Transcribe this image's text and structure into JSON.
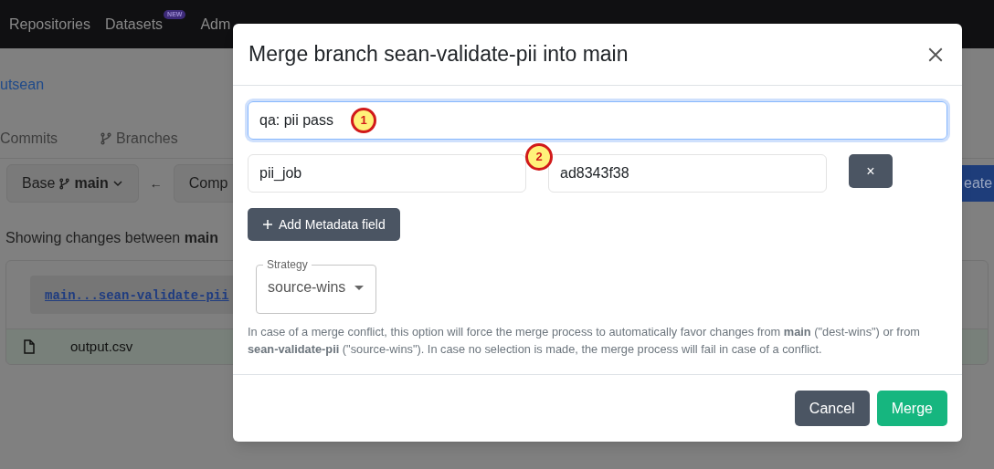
{
  "nav": {
    "items": [
      {
        "label": "Repositories"
      },
      {
        "label": "Datasets",
        "badge": "NEW"
      },
      {
        "label": "Adm"
      }
    ]
  },
  "breadcrumb": "utsean",
  "tabs": [
    {
      "label": "Commits",
      "kind": "plain"
    },
    {
      "label": "Branches",
      "kind": "branch"
    }
  ],
  "compare": {
    "base_label": "Base",
    "base_branch": "main",
    "arrow": "←",
    "compare_label": "Comp",
    "create_button": "eate"
  },
  "summary": {
    "text": "Showing changes between **main**"
  },
  "diff": {
    "range_link": "main...sean-validate-pii",
    "files": [
      {
        "name": "output.csv"
      }
    ]
  },
  "dialog": {
    "title": "Merge branch sean-validate-pii into main",
    "message": {
      "value": "qa: pii pass",
      "focused": true
    },
    "metadata": [
      {
        "key": "pii_job",
        "value": "ad8343f38",
        "remove": "×"
      }
    ],
    "add_button": "Add Metadata field",
    "strategy": {
      "label": "Strategy",
      "value": "source-wins"
    },
    "help": "In case of a merge conflict, this option will force the merge process to automatically favor changes from **main** (\"dest-wins\") or from **sean-validate-pii** (\"source-wins\"). In case no selection is made, the merge process will fail in case of a conflict.",
    "buttons": [
      {
        "label": "Cancel",
        "kind": "secondary"
      },
      {
        "label": "Merge",
        "kind": "primary"
      }
    ]
  },
  "markers": [
    {
      "label": "1"
    },
    {
      "label": "2"
    }
  ]
}
